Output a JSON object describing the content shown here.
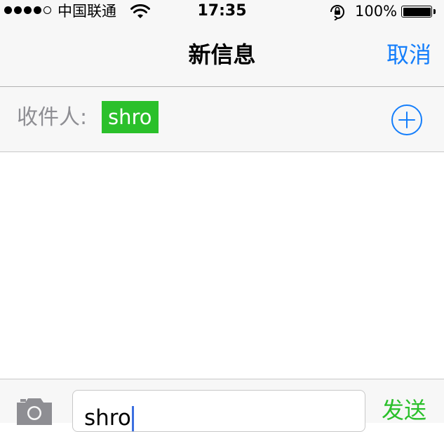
{
  "status_bar": {
    "carrier": "中国联通",
    "time": "17:35",
    "battery_percent": "100%",
    "signal_strength": 4,
    "signal_max": 5,
    "battery_level": 1.0
  },
  "nav": {
    "title": "新信息",
    "cancel_label": "取消"
  },
  "recipient": {
    "label": "收件人:",
    "chip_text": "shro"
  },
  "composer": {
    "input_value": "shro",
    "send_label": "发送"
  },
  "colors": {
    "accent_blue": "#147efb",
    "chip_green": "#2bc02b",
    "send_green": "#2bc02b",
    "bar_background": "#f7f7f7",
    "label_gray": "#8e8e93"
  },
  "icons": {
    "signal": "signal-dots-icon",
    "wifi": "wifi-icon",
    "orientation_lock": "orientation-lock-icon",
    "battery": "battery-icon",
    "add_contact": "add-circle-icon",
    "camera": "camera-icon"
  }
}
